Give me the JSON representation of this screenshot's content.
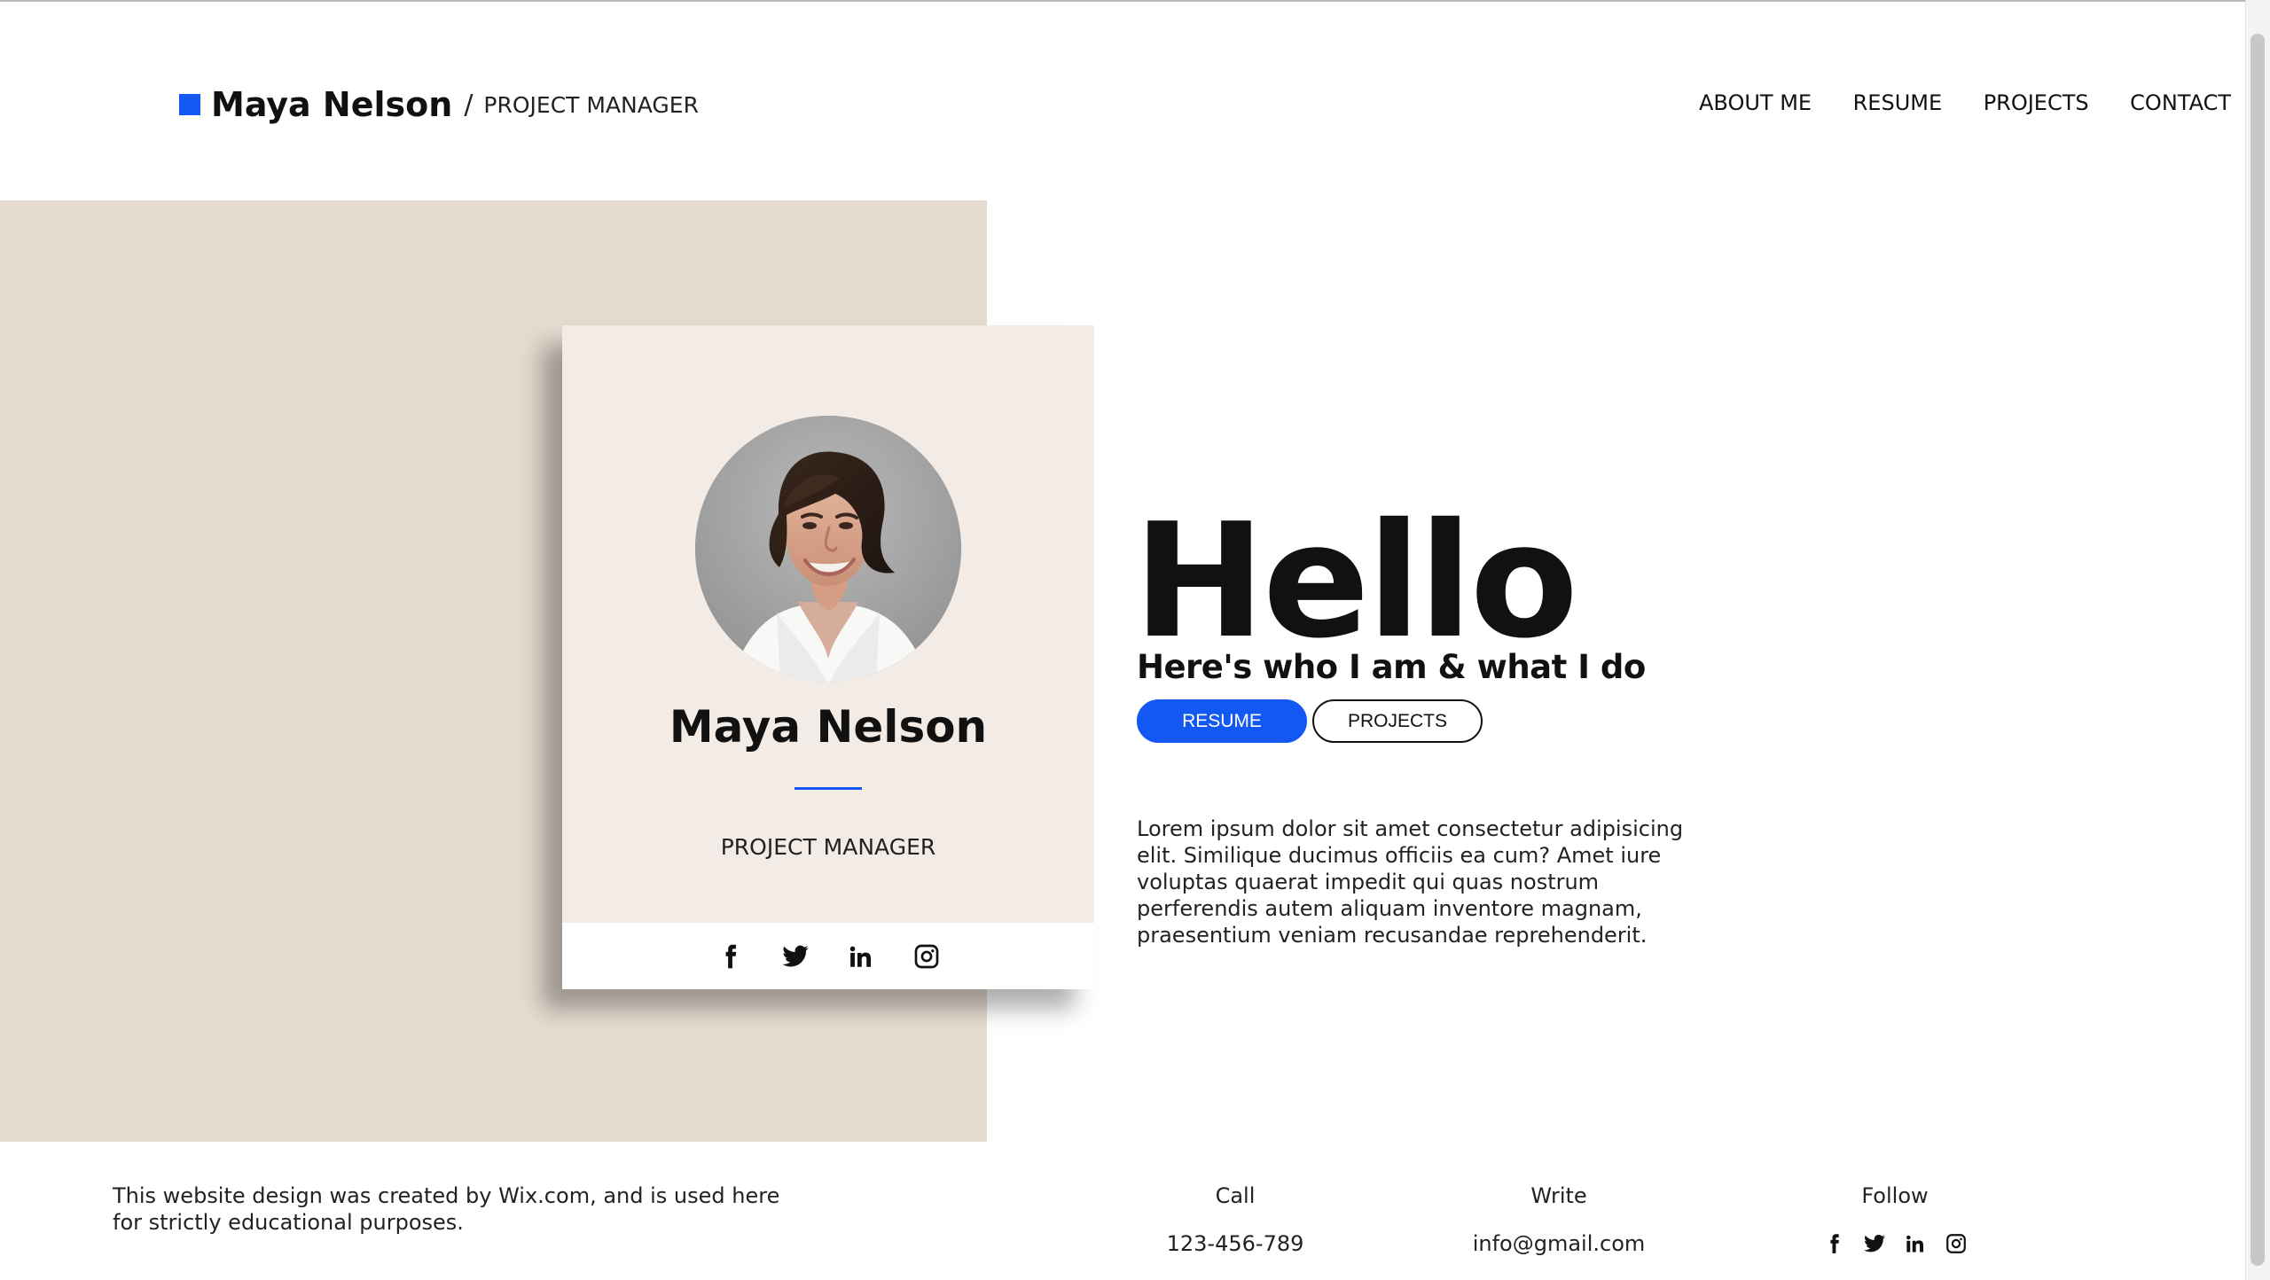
{
  "colors": {
    "accent": "#1358f2",
    "hero_background": "#e5dbd0",
    "card_background": "#f3ece6",
    "text": "#111111"
  },
  "brand": {
    "name": "Maya Nelson",
    "separator": "/",
    "role": "PROJECT MANAGER"
  },
  "nav": {
    "items": [
      {
        "label": "ABOUT ME"
      },
      {
        "label": "RESUME"
      },
      {
        "label": "PROJECTS"
      },
      {
        "label": "CONTACT"
      }
    ]
  },
  "profile_card": {
    "name": "Maya Nelson",
    "role": "PROJECT MANAGER",
    "social_icons": [
      "facebook-icon",
      "twitter-icon",
      "linkedin-icon",
      "instagram-icon"
    ]
  },
  "hero": {
    "title": "Hello",
    "subtitle": "Here's who I am & what I do",
    "buttons": {
      "resume": "RESUME",
      "projects": "PROJECTS"
    },
    "description": "Lorem ipsum dolor sit amet consectetur adipisicing elit. Similique ducimus officiis ea cum? Amet iure voluptas quaerat impedit qui quas nostrum perferendis autem aliquam inventore magnam, praesentium veniam recusandae reprehenderit."
  },
  "footer": {
    "credit": "This website design was created by Wix.com, and is used here for strictly educational purposes.",
    "call": {
      "label": "Call",
      "value": "123-456-789"
    },
    "write": {
      "label": "Write",
      "value": "info@gmail.com"
    },
    "follow": {
      "label": "Follow",
      "social_icons": [
        "facebook-icon",
        "twitter-icon",
        "linkedin-icon",
        "instagram-icon"
      ]
    }
  }
}
